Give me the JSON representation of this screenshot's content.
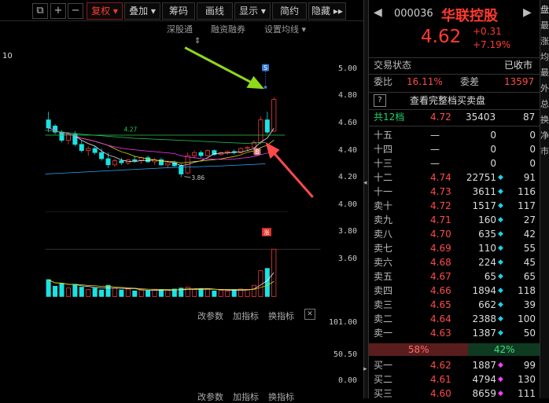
{
  "toolbar": {
    "buttons": [
      "复权",
      "叠加",
      "筹码",
      "画线",
      "显示",
      "简约",
      "隐藏"
    ],
    "sub_links": [
      "深股通",
      "融资融券",
      "设置均线"
    ]
  },
  "chart": {
    "ma_label": "10",
    "y_ticks": [
      "5.00",
      "4.80",
      "4.60",
      "4.40",
      "4.20",
      "4.00",
      "3.80",
      "3.60"
    ],
    "hline_label": "4.27",
    "low_label": "3.86",
    "signal_s": "S",
    "signal_b": "B",
    "limit_badge": "涨",
    "vol_ticks": [
      "101.00",
      "50.50",
      "0.00"
    ],
    "tool_links": [
      "改参数",
      "加指标",
      "换指标"
    ],
    "tool_links_bottom": [
      "改参数",
      "加指标",
      "换指标"
    ],
    "colors": {
      "up": "#ff3b3b",
      "down": "#19e3e3",
      "ma5": "#f0f0f0",
      "ma10": "#e8e000",
      "ma20": "#ff3cff",
      "ma60": "#22c86a",
      "ma120": "#2aa8ff",
      "arrow_green": "#8fd81a",
      "arrow_red": "#ff4a4a"
    }
  },
  "quote": {
    "code": "000036",
    "name": "华联控股",
    "price": "4.62",
    "change": "+0.31",
    "change_pct": "+7.19%",
    "status_label": "交易状态",
    "status_value": "已收市",
    "weibi_label": "委比",
    "weibi_value": "16.11%",
    "weicha_label": "委差",
    "weicha_value": "13597",
    "full_book": "查看完整档买卖盘",
    "gong_label": "共12档",
    "gong_price": "4.72",
    "gong_vol": "35403",
    "gong_n": "87",
    "asks": [
      {
        "label": "十五",
        "price": "—",
        "vol": "0",
        "n": "0"
      },
      {
        "label": "十四",
        "price": "—",
        "vol": "0",
        "n": "0"
      },
      {
        "label": "十三",
        "price": "—",
        "vol": "0",
        "n": "0"
      },
      {
        "label": "十二",
        "price": "4.74",
        "vol": "22751",
        "n": "91"
      },
      {
        "label": "十一",
        "price": "4.73",
        "vol": "3611",
        "n": "116"
      },
      {
        "label": "卖十",
        "price": "4.72",
        "vol": "1517",
        "n": "117"
      },
      {
        "label": "卖九",
        "price": "4.71",
        "vol": "160",
        "n": "27"
      },
      {
        "label": "卖八",
        "price": "4.70",
        "vol": "635",
        "n": "42"
      },
      {
        "label": "卖七",
        "price": "4.69",
        "vol": "110",
        "n": "55"
      },
      {
        "label": "卖六",
        "price": "4.68",
        "vol": "224",
        "n": "45"
      },
      {
        "label": "卖五",
        "price": "4.67",
        "vol": "65",
        "n": "65"
      },
      {
        "label": "卖四",
        "price": "4.66",
        "vol": "1894",
        "n": "118"
      },
      {
        "label": "卖三",
        "price": "4.65",
        "vol": "662",
        "n": "39"
      },
      {
        "label": "卖二",
        "price": "4.64",
        "vol": "2388",
        "n": "100"
      },
      {
        "label": "卖一",
        "price": "4.63",
        "vol": "1387",
        "n": "50"
      }
    ],
    "bar_buy_pct": "58%",
    "bar_sell_pct": "42%",
    "buy_ratio": 0.58,
    "bids": [
      {
        "label": "买一",
        "price": "4.62",
        "vol": "1887",
        "n": "99"
      },
      {
        "label": "买二",
        "price": "4.61",
        "vol": "4794",
        "n": "130"
      },
      {
        "label": "买三",
        "price": "4.60",
        "vol": "8659",
        "n": "111"
      }
    ],
    "strip_chars": [
      "盘",
      "最",
      "涨",
      "均",
      "最",
      "外",
      "总",
      "换",
      "净",
      "市"
    ]
  }
}
